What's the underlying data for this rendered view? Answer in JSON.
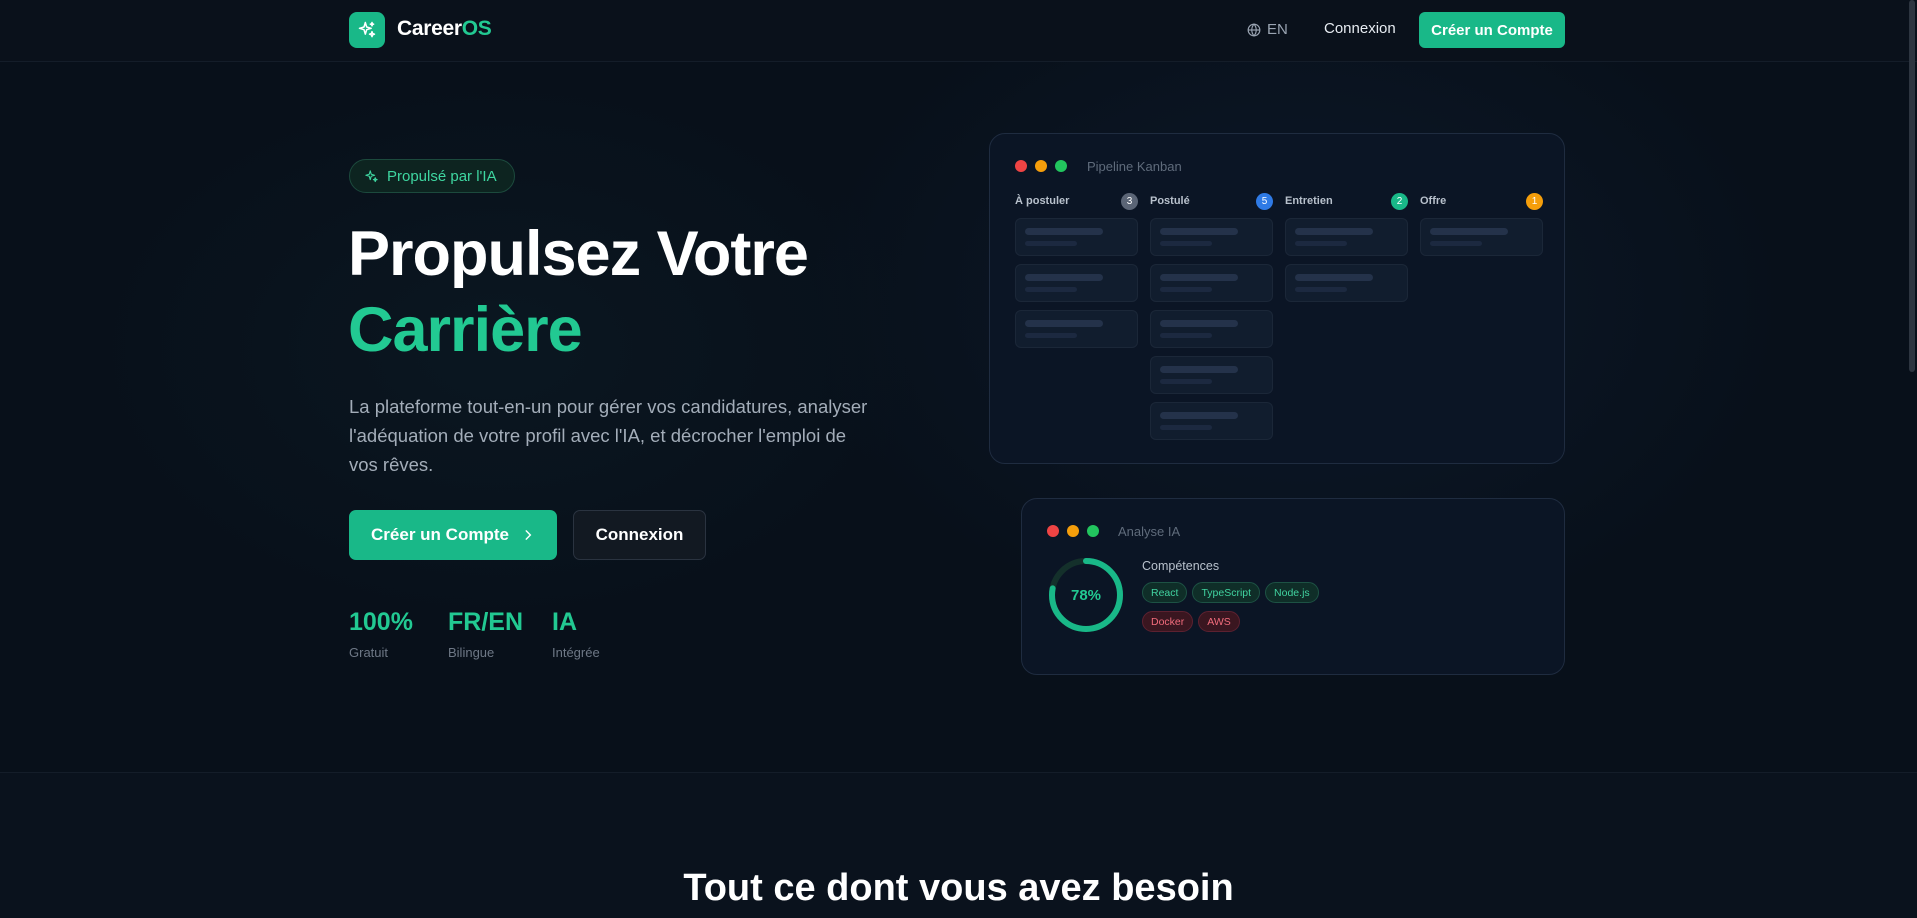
{
  "nav": {
    "brand_main": "Career",
    "brand_accent": "OS",
    "lang_label": "EN",
    "login_label": "Connexion",
    "signup_label": "Créer un Compte"
  },
  "hero": {
    "badge": "Propulsé par l'IA",
    "title_line1": "Propulsez Votre",
    "title_line2": "Carrière",
    "description": "La plateforme tout-en-un pour gérer vos candidatures, analyser l'adéquation de votre profil avec l'IA, et décrocher l'emploi de vos rêves.",
    "primary_cta": "Créer un Compte",
    "secondary_cta": "Connexion",
    "stats": [
      {
        "value": "100%",
        "label": "Gratuit"
      },
      {
        "value": "FR/EN",
        "label": "Bilingue"
      },
      {
        "value": "IA",
        "label": "Intégrée"
      }
    ]
  },
  "kanban": {
    "title": "Pipeline Kanban",
    "columns": [
      {
        "name": "À postuler",
        "count": "3",
        "color": "#5b6576"
      },
      {
        "name": "Postulé",
        "count": "5",
        "color": "#2f7ae5"
      },
      {
        "name": "Entretien",
        "count": "2",
        "color": "#19b888"
      },
      {
        "name": "Offre",
        "count": "1",
        "color": "#f59e0b"
      }
    ]
  },
  "analysis": {
    "title": "Analyse IA",
    "score": "78%",
    "score_fraction": 0.78,
    "skills_title": "Compétences",
    "matched": [
      "React",
      "TypeScript",
      "Node.js"
    ],
    "missing": [
      "Docker",
      "AWS"
    ]
  },
  "section": {
    "title": "Tout ce dont vous avez besoin"
  },
  "colors": {
    "accent": "#19b888",
    "accent_text": "#22c992",
    "background": "#08101a"
  }
}
